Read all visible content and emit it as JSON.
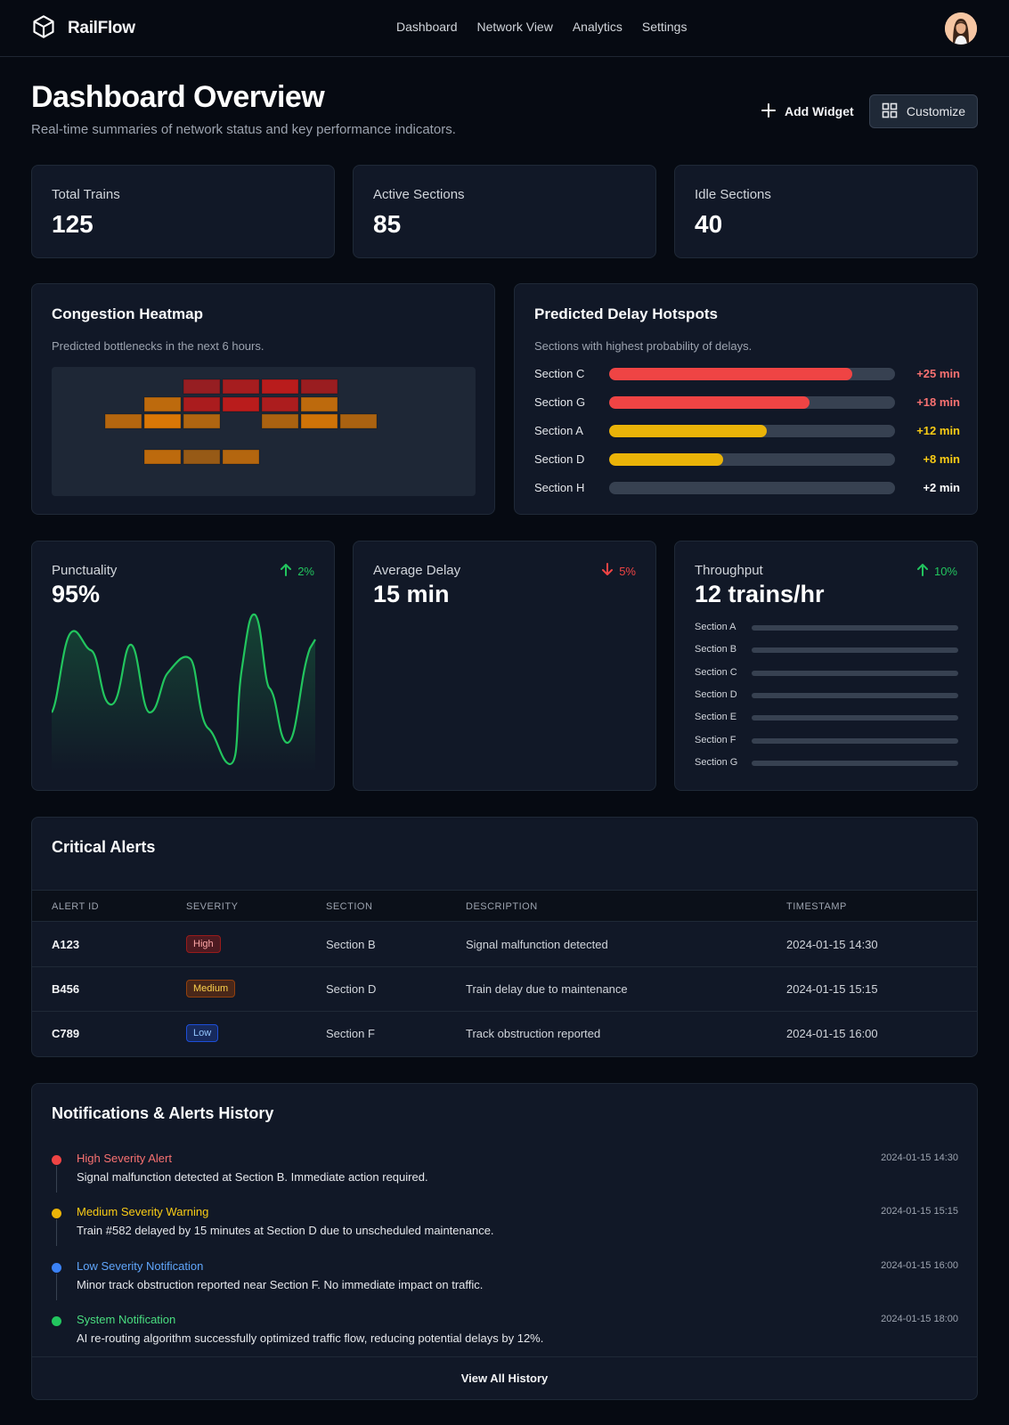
{
  "brand": {
    "name": "RailFlow",
    "logo_icon": "cube-icon"
  },
  "nav": {
    "items": [
      "Dashboard",
      "Network View",
      "Analytics",
      "Settings"
    ]
  },
  "header": {
    "title": "Dashboard Overview",
    "subtitle": "Real-time summaries of network status and key performance indicators.",
    "add_widget_label": "Add Widget",
    "customize_label": "Customize"
  },
  "stats": [
    {
      "label": "Total Trains",
      "value": "125"
    },
    {
      "label": "Active Sections",
      "value": "85"
    },
    {
      "label": "Idle Sections",
      "value": "40"
    }
  ],
  "heatmap": {
    "title": "Congestion Heatmap",
    "subtitle": "Predicted bottlenecks in the next 6 hours.",
    "colors": {
      "high": "#b91c1c",
      "med": "#d97706"
    }
  },
  "hotspots": {
    "title": "Predicted Delay Hotspots",
    "subtitle": "Sections with highest probability of delays.",
    "items": [
      {
        "label": "Section C",
        "value": "+25 min",
        "fill": 0.85,
        "color": "#ef4444",
        "text_color": "#f87171"
      },
      {
        "label": "Section G",
        "value": "+18 min",
        "fill": 0.7,
        "color": "#ef4444",
        "text_color": "#f87171"
      },
      {
        "label": "Section A",
        "value": "+12 min",
        "fill": 0.55,
        "color": "#eab308",
        "text_color": "#facc15"
      },
      {
        "label": "Section D",
        "value": "+8 min",
        "fill": 0.4,
        "color": "#eab308",
        "text_color": "#facc15"
      },
      {
        "label": "Section H",
        "value": "+2 min",
        "fill": 0.0,
        "color": "#6b7280",
        "text_color": "#ffffff"
      }
    ]
  },
  "kpis": {
    "punctuality": {
      "label": "Punctuality",
      "value": "95%",
      "change": "2%",
      "direction": "up"
    },
    "avg_delay": {
      "label": "Average Delay",
      "value": "15 min",
      "change": "5%",
      "direction": "down"
    },
    "throughput": {
      "label": "Throughput",
      "value": "12 trains/hr",
      "change": "10%",
      "direction": "up",
      "sections": [
        "Section A",
        "Section B",
        "Section C",
        "Section D",
        "Section E",
        "Section F",
        "Section G"
      ]
    }
  },
  "colors": {
    "up": "#22c55e",
    "down": "#ef4444",
    "accent_green": "#22c55e"
  },
  "alerts": {
    "title": "Critical Alerts",
    "columns": [
      "ALERT ID",
      "SEVERITY",
      "SECTION",
      "DESCRIPTION",
      "TIMESTAMP"
    ],
    "rows": [
      {
        "id": "A123",
        "severity": "High",
        "section": "Section B",
        "description": "Signal malfunction detected",
        "timestamp": "2024-01-15 14:30"
      },
      {
        "id": "B456",
        "severity": "Medium",
        "section": "Section D",
        "description": "Train delay due to maintenance",
        "timestamp": "2024-01-15 15:15"
      },
      {
        "id": "C789",
        "severity": "Low",
        "section": "Section F",
        "description": "Track obstruction reported",
        "timestamp": "2024-01-15 16:00"
      }
    ]
  },
  "history": {
    "title": "Notifications & Alerts History",
    "items": [
      {
        "title": "High Severity Alert",
        "desc": "Signal malfunction detected at Section B. Immediate action required.",
        "time": "2024-01-15 14:30",
        "color": "#ef4444",
        "title_color": "#f87171"
      },
      {
        "title": "Medium Severity Warning",
        "desc": "Train #582 delayed by 15 minutes at Section D due to unscheduled maintenance.",
        "time": "2024-01-15 15:15",
        "color": "#eab308",
        "title_color": "#facc15"
      },
      {
        "title": "Low Severity Notification",
        "desc": "Minor track obstruction reported near Section F. No immediate impact on traffic.",
        "time": "2024-01-15 16:00",
        "color": "#3b82f6",
        "title_color": "#60a5fa"
      },
      {
        "title": "System Notification",
        "desc": "AI re-routing algorithm successfully optimized traffic flow, reducing potential delays by 12%.",
        "time": "2024-01-15 18:00",
        "color": "#22c55e",
        "title_color": "#4ade80"
      }
    ],
    "footer_label": "View All History"
  }
}
